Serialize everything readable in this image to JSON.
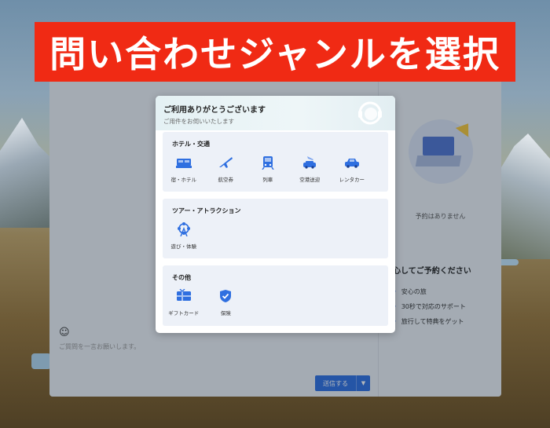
{
  "banner": {
    "text": "問い合わせジャンルを選択"
  },
  "chat": {
    "placeholder": "ご質問を一言お願いします。",
    "send_label": "送信する",
    "send_dropdown": "▼"
  },
  "side": {
    "no_reservation": "予約はありません",
    "reassure_title": "心してご予約ください",
    "items": [
      "安心の旅",
      "30秒で対応のサポート",
      "旅行して特典をゲット"
    ]
  },
  "modal": {
    "title": "ご利用ありがとうございます",
    "subtitle": "ご用件をお伺いいたします",
    "sections": [
      {
        "title": "ホテル・交通",
        "items": [
          {
            "label": "宿・ホテル",
            "icon": "bed-icon"
          },
          {
            "label": "航空券",
            "icon": "airplane-icon"
          },
          {
            "label": "列車",
            "icon": "train-icon"
          },
          {
            "label": "空港送迎",
            "icon": "airport-transfer-icon"
          },
          {
            "label": "レンタカー",
            "icon": "car-icon"
          }
        ]
      },
      {
        "title": "ツアー・アトラクション",
        "items": [
          {
            "label": "遊び・体験",
            "icon": "ferris-wheel-icon"
          }
        ]
      },
      {
        "title": "その他",
        "items": [
          {
            "label": "ギフトカード",
            "icon": "gift-card-icon"
          },
          {
            "label": "保険",
            "icon": "shield-check-icon"
          }
        ]
      }
    ]
  },
  "colors": {
    "accent": "#2f6fe0",
    "banner": "#f02a14"
  }
}
